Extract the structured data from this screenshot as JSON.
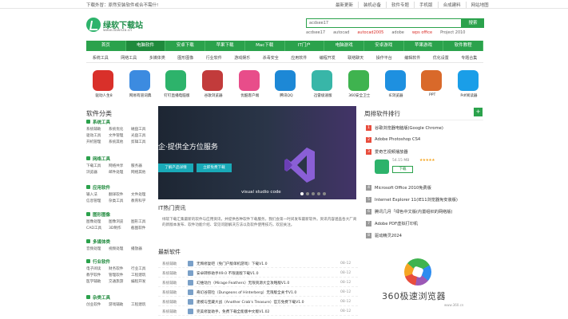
{
  "topbar": {
    "notice": "下载外冒：原然安装软件或合不需什!",
    "links": [
      "最新更新",
      "装机必备",
      "软件专题",
      "手机版",
      "合成建料",
      "网站地图"
    ]
  },
  "logo": {
    "name": "绿软下载站",
    "url": "www.downza.cn"
  },
  "search": {
    "value": "acdsee17",
    "button": "搜索",
    "hot": [
      "acdsee17",
      "autocad",
      "autocad2005",
      "adobe",
      "wps office",
      "Project 2010"
    ]
  },
  "nav": [
    "首页",
    "电脑软件",
    "安卓下载",
    "苹果下载",
    "Mac下载",
    "IT门户",
    "电脑游戏",
    "安卓游戏",
    "苹果游戏",
    "软件教程"
  ],
  "subnav": [
    "系统工具",
    "网络工具",
    "多媒体类",
    "图形图像",
    "行业软件",
    "游戏娱乐",
    "杀毒安全",
    "应用软件",
    "编程开发",
    "联络聊天",
    "操作平台",
    "编辑软件",
    "优化设置",
    "专题合集"
  ],
  "apps": [
    {
      "label": "驱动人生8",
      "color": "#d9302a"
    },
    {
      "label": "网易有道词典",
      "color": "#3c8be0"
    },
    {
      "label": "钉钉直播电脑版",
      "color": "#2db36b"
    },
    {
      "label": "谷歌浏览器",
      "color": "#c23b3b"
    },
    {
      "label": "优酷客户端",
      "color": "#e84d8a"
    },
    {
      "label": "腾讯QQ",
      "color": "#1d88d6"
    },
    {
      "label": "迅雷极速版",
      "color": "#38b6a8"
    },
    {
      "label": "360安全卫士",
      "color": "#3fb34f"
    },
    {
      "label": "IE浏览器",
      "color": "#1e90e0"
    },
    {
      "label": "PPT",
      "color": "#d9692a"
    },
    {
      "label": "Pdf阅读器",
      "color": "#1a9ee8"
    }
  ],
  "categories": {
    "title": "软件分类",
    "groups": [
      {
        "name": "系统工具",
        "items": [
          "系统辅助",
          "系统优化",
          "磁盘工具",
          "驱动工具",
          "文件管理",
          "光盘工具",
          "开机管理",
          "系统其他",
          "剪辑工具"
        ]
      },
      {
        "name": "网络工具",
        "items": [
          "下载工具",
          "网络共享",
          "服务器",
          "浏览器",
          "邮件处理",
          "网络其他"
        ]
      },
      {
        "name": "应用软件",
        "items": [
          "输入法",
          "翻译软件",
          "文件处理",
          "信息管理",
          "杂类工具",
          "教育科学"
        ]
      },
      {
        "name": "图形图像",
        "items": [
          "图像处理",
          "图像浏览",
          "图形工具",
          "CAD工具",
          "3D制作",
          "截图软件"
        ]
      },
      {
        "name": "多媒体类",
        "items": [
          "音频处理",
          "视频处理",
          "播放器"
        ]
      },
      {
        "name": "行业软件",
        "items": [
          "电子阅读",
          "财务软件",
          "行业工具",
          "教学软件",
          "管理软件",
          "工程建筑",
          "医学辅助",
          "交通旅游",
          "编程开发"
        ]
      },
      {
        "name": "杂类工具",
        "items": [
          "创业软件",
          "游戏辅助",
          "工程建筑"
        ]
      }
    ]
  },
  "banner": {
    "tagline": "企·提供全方位服务",
    "btn1": "了解产品详情",
    "btn2": "立即免费下载",
    "caption": "visual studio code"
  },
  "news": {
    "title": "IT热门资讯",
    "text": "绿软下载汇集最新的软件与应用资讯，并提供各种软件下载服务，我们会第一时间发布最新软件。资讯内容涵盖各大厂商的新版本发布、软件功能介绍、常见问题解决方法以及软件使用技巧，欢迎关注。"
  },
  "latest": {
    "title": "最新软件",
    "rows": [
      {
        "cat": "系统辅助",
        "title": "无悔修复吧（免门户版单机游戏）下载V1.0",
        "date": "08-12"
      },
      {
        "cat": "系统辅助",
        "title": "安卓转移助手X9.0 不限速版下载V1.0",
        "date": "08-12"
      },
      {
        "cat": "系统辅助",
        "title": "幻维动力（Mirage Feathers）无限资源大全攻略版V1.0",
        "date": "08-12"
      },
      {
        "cat": "系统辅助",
        "title": "奇幻谷冒险（Dungeons of Hinterberg）无限版全关卡V1.0",
        "date": "08-12"
      },
      {
        "cat": "系统辅助",
        "title": "建模与宝藏大战（Another Crab's Treasure）官方免费下载V1.0",
        "date": "08-12"
      },
      {
        "cat": "系统辅助",
        "title": "完美修复助手，免费下载全能版中文版V1.02",
        "date": "08-12"
      }
    ]
  },
  "ranking": {
    "title": "周排软件排行",
    "more": "+",
    "items": [
      "谷歌浏览器电脑版(Google Chrome)",
      "Adobe Photoshop CS4",
      "爱奇艺视频播放器",
      "Microsoft Office 2010免费版",
      "Internet Explorer 11(IE11浏览器免安装版)",
      "腾讯几月「绿色中文版(内置组织的网络版)",
      "Adobe PDF虚拟打印机",
      "驱动精灵2024"
    ],
    "featured": {
      "size": "54.15 MB",
      "stars": "★★★★★",
      "button": "下载"
    }
  },
  "ad": {
    "text": "360极速浏览器",
    "sub": "www.360.cn"
  }
}
